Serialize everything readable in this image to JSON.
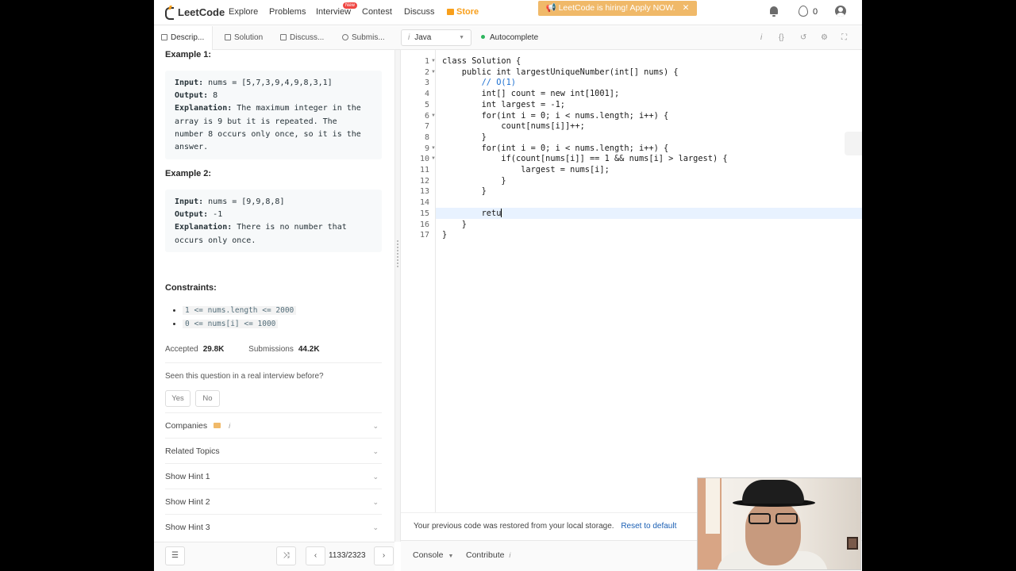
{
  "nav": {
    "logo": "LeetCode",
    "items": [
      "Explore",
      "Problems",
      "Interview",
      "Contest",
      "Discuss",
      "Store"
    ],
    "new_badge": "New",
    "hiring_banner": "LeetCode is hiring! Apply NOW.",
    "streak_count": "0"
  },
  "tabs": {
    "description": "Descrip...",
    "solution": "Solution",
    "discuss": "Discuss...",
    "submissions": "Submis...",
    "language": "Java",
    "autocomplete": "Autocomplete"
  },
  "problem": {
    "example1_title": "Example 1:",
    "example1": {
      "input_label": "Input:",
      "input": " nums = [5,7,3,9,4,9,8,3,1]",
      "output_label": "Output:",
      "output": " 8",
      "expl_label": "Explanation:",
      "expl_l1": " The maximum integer in the",
      "expl_l2": "array is 9 but it is repeated. The",
      "expl_l3": "number 8 occurs only once, so it is the",
      "expl_l4": "answer."
    },
    "example2_title": "Example 2:",
    "example2": {
      "input_label": "Input:",
      "input": " nums = [9,9,8,8]",
      "output_label": "Output:",
      "output": " -1",
      "expl_label": "Explanation:",
      "expl_l1": " There is no number that",
      "expl_l2": "occurs only once."
    },
    "constraints_title": "Constraints:",
    "constraints": [
      "1 <= nums.length <= 2000",
      "0 <= nums[i] <= 1000"
    ],
    "accepted_label": "Accepted",
    "accepted": "29.8K",
    "submissions_label": "Submissions",
    "submissions": "44.2K",
    "seen_question": "Seen this question in a real interview before?",
    "yes": "Yes",
    "no": "No",
    "accordions": [
      "Companies",
      "Related Topics",
      "Show Hint 1",
      "Show Hint 2",
      "Show Hint 3"
    ]
  },
  "pager": {
    "position": "1133/2323"
  },
  "code": {
    "lines": [
      "class Solution {",
      "    public int largestUniqueNumber(int[] nums) {",
      "        // O(1)",
      "        int[] count = new int[1001];",
      "        int largest = -1;",
      "        for(int i = 0; i < nums.length; i++) {",
      "            count[nums[i]]++;",
      "        }",
      "        for(int i = 0; i < nums.length; i++) {",
      "            if(count[nums[i]] == 1 && nums[i] > largest) {",
      "                largest = nums[i];",
      "            }",
      "        }",
      "",
      "        retu",
      "    }",
      "}"
    ]
  },
  "editor_footer": {
    "restore_msg": "Your previous code was restored from your local storage.",
    "reset_link": "Reset to default",
    "console": "Console",
    "contribute": "Contribute"
  },
  "colors": {
    "accent": "#f89f1b",
    "active_line": "#e8f2ff",
    "link": "#1a5fb4"
  }
}
